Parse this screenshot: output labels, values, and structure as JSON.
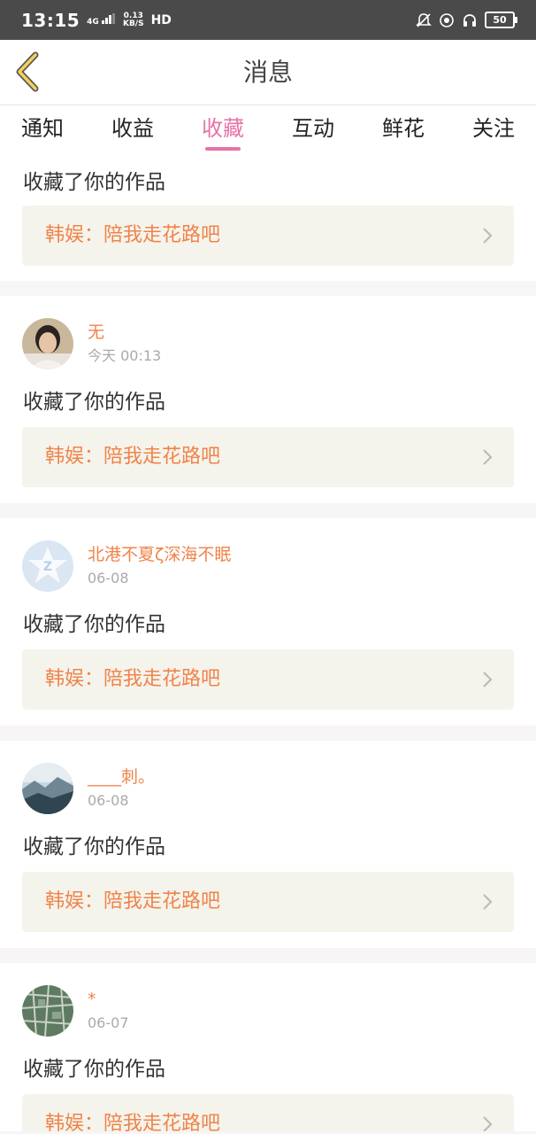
{
  "status_bar": {
    "time": "13:15",
    "network_type": "4G",
    "speed_value": "0.13",
    "speed_unit": "KB/S",
    "hd": "HD",
    "battery": "50"
  },
  "header": {
    "title": "消息"
  },
  "tabs": [
    {
      "label": "通知"
    },
    {
      "label": "收益"
    },
    {
      "label": "收藏",
      "active": true
    },
    {
      "label": "互动"
    },
    {
      "label": "鲜花"
    },
    {
      "label": "关注"
    }
  ],
  "messages": [
    {
      "action": "收藏了你的作品",
      "work_title": "韩娱：陪我走花路吧"
    },
    {
      "username": "无",
      "time": "今天 00:13",
      "action": "收藏了你的作品",
      "work_title": "韩娱：陪我走花路吧",
      "avatar": "person-photo"
    },
    {
      "username": "北港不夏ζ深海不眠",
      "time": "06-08",
      "action": "收藏了你的作品",
      "work_title": "韩娱：陪我走花路吧",
      "avatar": "qq-default"
    },
    {
      "username": "____刺。",
      "time": "06-08",
      "action": "收藏了你的作品",
      "work_title": "韩娱：陪我走花路吧",
      "avatar": "mountain-photo"
    },
    {
      "username": "*",
      "time": "06-07",
      "action": "收藏了你的作品",
      "work_title": "韩娱：陪我走花路吧",
      "avatar": "map-photo"
    }
  ],
  "colors": {
    "accent": "#e772a9",
    "username": "#f0834a",
    "work_bg": "#f5f4ec",
    "status_bar": "#4a4a4a"
  }
}
